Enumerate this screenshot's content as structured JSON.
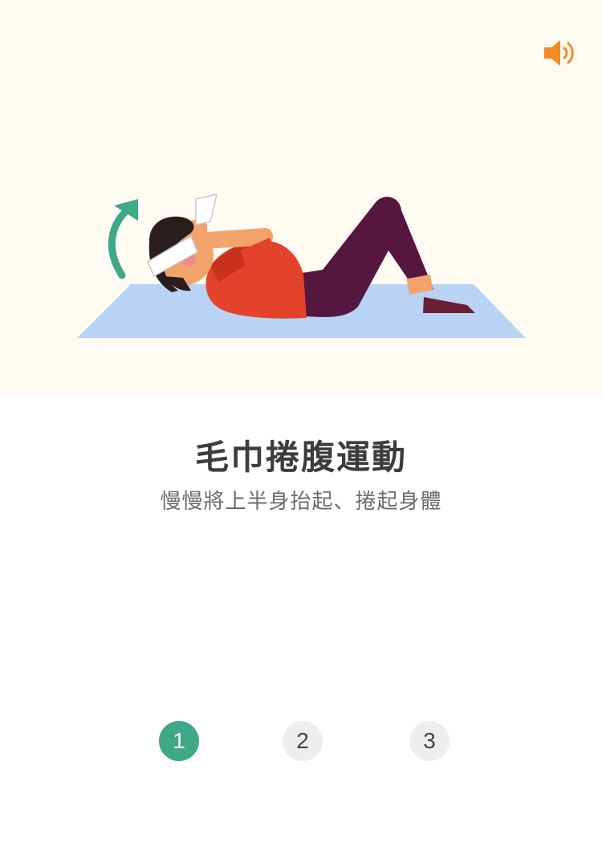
{
  "exercise": {
    "title": "毛巾捲腹運動",
    "description": "慢慢將上半身抬起、捲起身體"
  },
  "sound": {
    "icon": "speaker-icon",
    "color": "#f08a24"
  },
  "steps": {
    "items": [
      "1",
      "2",
      "3"
    ],
    "active_index": 0,
    "active_color": "#3fa886"
  },
  "colors": {
    "hero_background": "#fffaf2",
    "mat": "#b9d3f5",
    "arrow": "#3fa886",
    "shirt": "#e2432a",
    "pants": "#55163f"
  }
}
